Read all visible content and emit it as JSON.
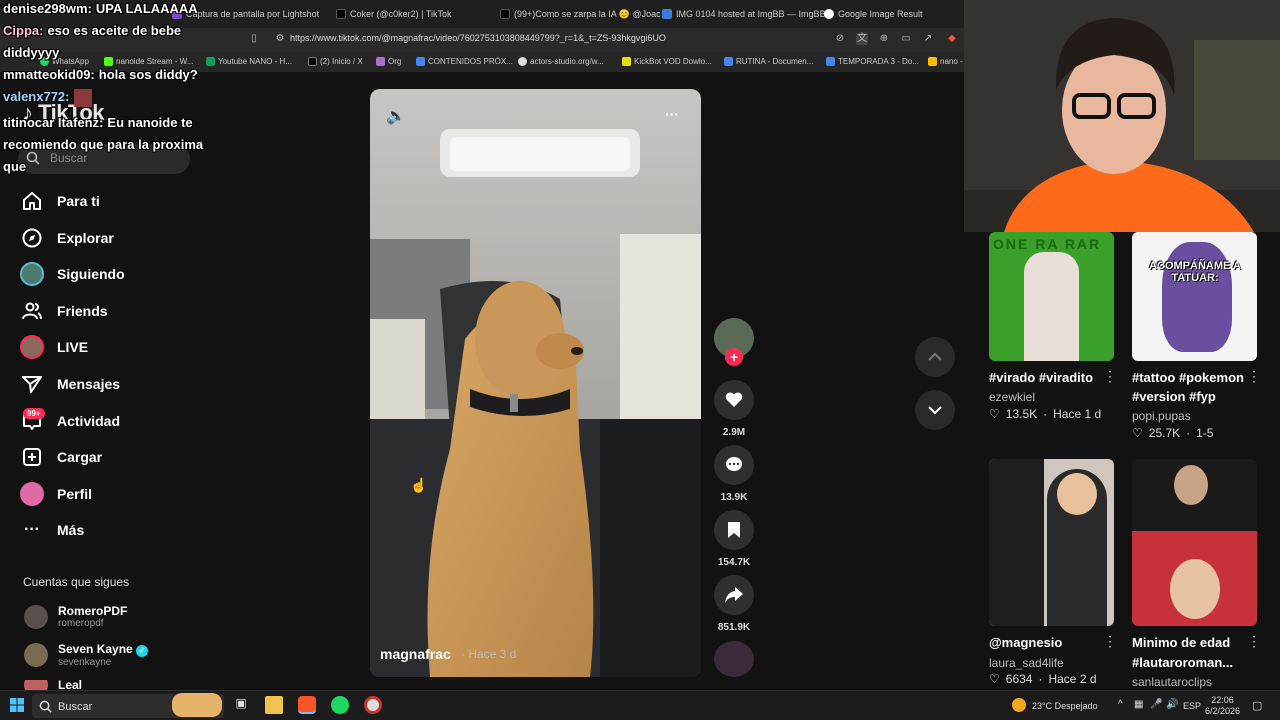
{
  "browser": {
    "tabs": [
      {
        "label": "Coker (@c0ker2) | TikTok",
        "icon": "tiktok-icon"
      },
      {
        "label": "(99+)Como se zarpa la IA 😊 @Joac",
        "icon": "tiktok-icon"
      },
      {
        "label": "IMG 0104 hosted at ImgBB — ImgBB",
        "icon": "imgbb-icon"
      },
      {
        "label": "Google Image Result",
        "icon": "google-icon"
      }
    ],
    "partial_tab": "Captura de pantalla por Lightshot",
    "url": "https://www.tiktok.com/@magnafrac/video/7602753103808449799?_r=1&_t=ZS-93hkgvgi6UO",
    "bookmarks": [
      {
        "label": "WhatsApp",
        "color": "#25d366"
      },
      {
        "label": "nanoide Stream - W...",
        "color": "#ff6a00"
      },
      {
        "label": "Youtube NANO - H...",
        "color": "#3ac100"
      },
      {
        "label": "(2) Inicio / X",
        "color": "#ffffff"
      },
      {
        "label": "Org",
        "color": "#b06bd0"
      },
      {
        "label": "CONTENIDOS PRÓX...",
        "color": "#4285f4"
      },
      {
        "label": "actors-studio.org/w...",
        "color": "#dddddd"
      },
      {
        "label": "KickBot VOD Dowlo...",
        "color": "#e8e000"
      },
      {
        "label": "RUTINA - Documen...",
        "color": "#4285f4"
      },
      {
        "label": "TEMPORADA 3 - Do...",
        "color": "#4285f4"
      },
      {
        "label": "nano -",
        "color": "#fbbc04"
      }
    ]
  },
  "chat": [
    {
      "user": "denise298wm:",
      "msg": "UPA LALAAAAA"
    },
    {
      "user": "Cippa:",
      "msg": "eso es aceite de bebe"
    },
    {
      "user": "",
      "msg": "diddyyyy"
    },
    {
      "user": "mmatteokid09:",
      "msg": "hola sos diddy?"
    },
    {
      "user": "valenx772:",
      "msg": ""
    },
    {
      "user": "titinocar Itafenz:",
      "msg": "Eu nanoide te"
    },
    {
      "user": "",
      "msg": "recomiendo que para la proxima"
    },
    {
      "user": "",
      "msg": "que"
    }
  ],
  "tiktok": {
    "logo": "TikTok",
    "search_placeholder": "Buscar",
    "nav": [
      {
        "label": "Para ti",
        "icon": "home-icon"
      },
      {
        "label": "Explorar",
        "icon": "compass-icon"
      },
      {
        "label": "Siguiendo",
        "icon": "following-avatar-icon"
      },
      {
        "label": "Friends",
        "icon": "friends-icon"
      },
      {
        "label": "LIVE",
        "icon": "live-avatar-icon"
      },
      {
        "label": "Mensajes",
        "icon": "send-icon"
      },
      {
        "label": "Actividad",
        "icon": "inbox-icon"
      },
      {
        "label": "Cargar",
        "icon": "upload-icon"
      },
      {
        "label": "Perfil",
        "icon": "profile-avatar-icon"
      },
      {
        "label": "Más",
        "icon": "more-dots-icon"
      }
    ],
    "activity_badge": "99+",
    "following_title": "Cuentas que sigues",
    "following": [
      {
        "name": "RomeroPDF",
        "handle": "romeropdf",
        "verified": false,
        "color": "#5a4f4a"
      },
      {
        "name": "Seven Kayne",
        "handle": "sevenkayne",
        "verified": true,
        "color": "#7a6a52"
      },
      {
        "name": "Leal",
        "handle": "",
        "verified": false,
        "color": "#c06060"
      }
    ],
    "video": {
      "author": "magnafrac",
      "time": "· Hace 3 d",
      "likes": "2.9M",
      "comments": "13.9K",
      "saves": "154.7K",
      "shares": "851.9K"
    },
    "recommended": [
      {
        "title": "#virado #viradito",
        "author": "ezewkiel",
        "likes": "13.5K",
        "time": "Hace 1 d",
        "thumb_text": "ONE RA RAR"
      },
      {
        "title": "#tattoo #pokemon",
        "title2": "#version #fyp",
        "author": "popi.pupas",
        "likes": "25.7K",
        "time": "1-5",
        "thumb_text": "ACOMPÁÑAME A TATUAR:"
      },
      {
        "title": "@magnesio",
        "author": "laura_sad4life",
        "likes": "6634",
        "time": "Hace 2 d"
      },
      {
        "title": "Minimo de edad",
        "title2": "#lautaroroman...",
        "author": "sanlautaroclips"
      }
    ]
  },
  "taskbar": {
    "search": "Buscar",
    "weather": "23°C  Despejado",
    "lang": "ESP",
    "time": "22:06",
    "date": "6/2/2026"
  },
  "colors": {
    "accent": "#fe2c55",
    "bg": "#121212"
  }
}
